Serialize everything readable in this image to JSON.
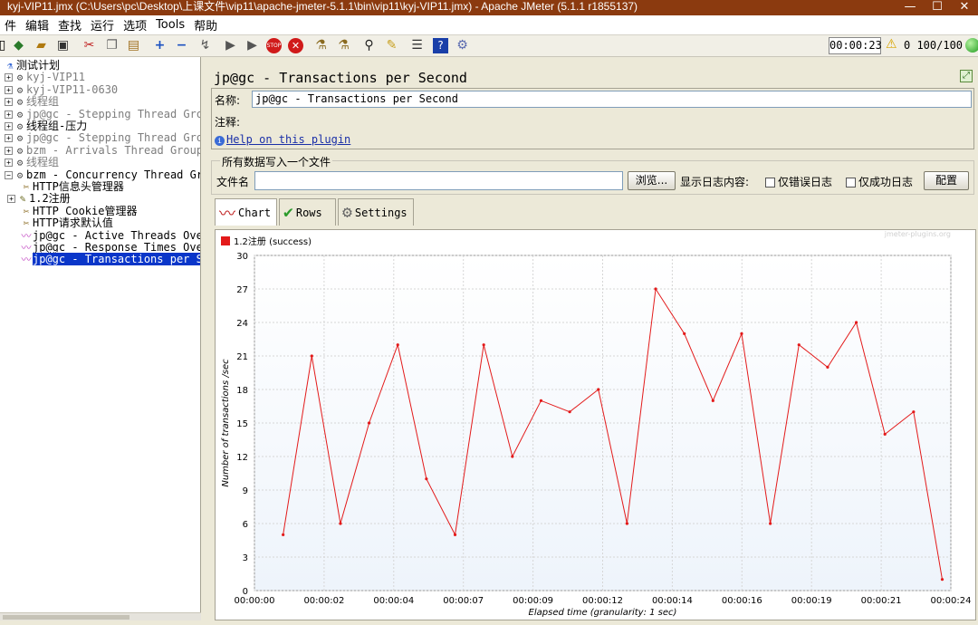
{
  "window": {
    "title": "kyj-VIP11.jmx (C:\\Users\\pc\\Desktop\\上课文件\\vip11\\apache-jmeter-5.1.1\\bin\\vip11\\kyj-VIP11.jmx) - Apache JMeter (5.1.1 r1855137)",
    "minimize": "—",
    "maximize": "☐",
    "close": "✕"
  },
  "menu": [
    "件",
    "编辑",
    "查找",
    "运行",
    "选项",
    "Tools",
    "帮助"
  ],
  "status": {
    "timer": "00:00:23",
    "threads": "0 100/100"
  },
  "tree": [
    {
      "label": "测试计划",
      "depth": 0,
      "state": "normal",
      "icon": "flask-icon"
    },
    {
      "label": "kyj-VIP11",
      "depth": 1,
      "state": "grey",
      "icon": "thread-group-icon"
    },
    {
      "label": "kyj-VIP11-0630",
      "depth": 1,
      "state": "grey",
      "icon": "thread-group-icon"
    },
    {
      "label": "线程组",
      "depth": 1,
      "state": "grey",
      "icon": "thread-group-icon"
    },
    {
      "label": "jp@gc - Stepping Thread Group",
      "depth": 1,
      "state": "grey",
      "icon": "thread-group-icon"
    },
    {
      "label": "线程组-压力",
      "depth": 1,
      "state": "normal",
      "icon": "thread-group-icon"
    },
    {
      "label": "jp@gc - Stepping Thread Group",
      "depth": 1,
      "state": "grey",
      "icon": "thread-group-icon"
    },
    {
      "label": "bzm - Arrivals Thread Group",
      "depth": 1,
      "state": "grey",
      "icon": "thread-group-icon"
    },
    {
      "label": "线程组",
      "depth": 1,
      "state": "grey",
      "icon": "thread-group-icon"
    },
    {
      "label": "bzm - Concurrency Thread Group",
      "depth": 1,
      "state": "normal",
      "icon": "thread-group-icon"
    },
    {
      "label": "HTTP信息头管理器",
      "depth": 2,
      "state": "normal",
      "icon": "config-icon"
    },
    {
      "label": "1.2注册",
      "depth": 2,
      "state": "normal",
      "icon": "sampler-icon"
    },
    {
      "label": "HTTP Cookie管理器",
      "depth": 2,
      "state": "normal",
      "icon": "config-icon"
    },
    {
      "label": "HTTP请求默认值",
      "depth": 2,
      "state": "normal",
      "icon": "config-icon"
    },
    {
      "label": "jp@gc - Active Threads Over Time",
      "depth": 2,
      "state": "normal",
      "icon": "listener-icon"
    },
    {
      "label": "jp@gc - Response Times Over Time",
      "depth": 2,
      "state": "normal",
      "icon": "listener-icon"
    },
    {
      "label": "jp@gc - Transactions per Second",
      "depth": 2,
      "state": "selected",
      "icon": "listener-icon"
    }
  ],
  "panel": {
    "title": "jp@gc - Transactions per Second",
    "name_label": "名称:",
    "name_value": "jp@gc - Transactions per Second",
    "comment_label": "注释:",
    "help_link": "Help on this plugin",
    "file_section": "所有数据写入一个文件",
    "file_label": "文件名",
    "browse": "浏览...",
    "log_label": "显示日志内容:",
    "errors_only": "仅错误日志",
    "success_only": "仅成功日志",
    "config": "配置",
    "tabs": [
      "Chart",
      "Rows",
      "Settings"
    ]
  },
  "chart_data": {
    "type": "line",
    "watermark": "jmeter-plugins.org",
    "xlabel": "Elapsed time (granularity: 1 sec)",
    "ylabel": "Number of transactions /sec",
    "ylim": [
      0,
      30
    ],
    "yticks": [
      0,
      3,
      6,
      9,
      12,
      15,
      18,
      21,
      24,
      27,
      30
    ],
    "xticks": [
      "00:00:00",
      "00:00:02",
      "00:00:04",
      "00:00:07",
      "00:00:09",
      "00:00:12",
      "00:00:14",
      "00:00:16",
      "00:00:19",
      "00:00:21",
      "00:00:24"
    ],
    "xlim_seconds": [
      0,
      24.3
    ],
    "grid": true,
    "legend": "top-left",
    "series": [
      {
        "name": "1.2注册 (success)",
        "color": "#e31a1a",
        "x": [
          1,
          2,
          3,
          4,
          5,
          6,
          7,
          8,
          9,
          10,
          11,
          12,
          13,
          14,
          15,
          16,
          17,
          18,
          19,
          20,
          21,
          22,
          23,
          24
        ],
        "y": [
          5,
          21,
          6,
          15,
          22,
          10,
          5,
          22,
          12,
          17,
          16,
          18,
          6,
          27,
          23,
          17,
          23,
          6,
          22,
          20,
          24,
          14,
          16,
          1
        ]
      }
    ]
  }
}
